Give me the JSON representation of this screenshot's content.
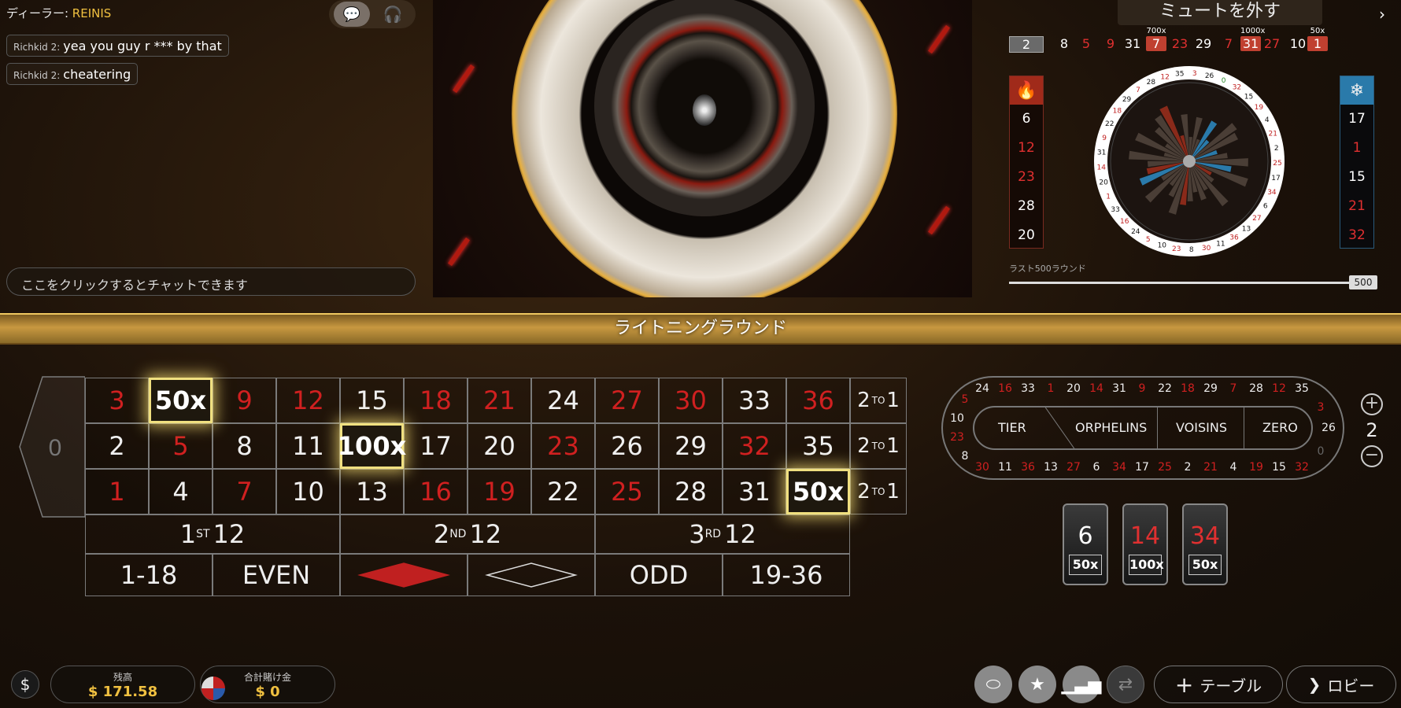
{
  "chat": {
    "dealer_label": "ディーラー:",
    "dealer_name": "REINIS",
    "messages": [
      {
        "user": "Richkid 2:",
        "text": "yea you guy r *** by that"
      },
      {
        "user": "Richkid 2:",
        "text": "cheatering"
      }
    ],
    "input_placeholder": "ここをクリックするとチャットできます"
  },
  "stats": {
    "mute_label": "ミュートを外す",
    "recent_results": [
      {
        "n": "2",
        "c": "w"
      },
      {
        "n": "8",
        "c": "w"
      },
      {
        "n": "5",
        "c": "r"
      },
      {
        "n": "9",
        "c": "r"
      },
      {
        "n": "31",
        "c": "w"
      },
      {
        "n": "7",
        "c": "r",
        "mult": "700x"
      },
      {
        "n": "23",
        "c": "r"
      },
      {
        "n": "29",
        "c": "w"
      },
      {
        "n": "7",
        "c": "r"
      },
      {
        "n": "31",
        "c": "w",
        "mult": "1000x"
      },
      {
        "n": "27",
        "c": "r"
      },
      {
        "n": "10",
        "c": "w"
      },
      {
        "n": "1",
        "c": "r",
        "mult": "50x"
      }
    ],
    "hot_numbers": [
      {
        "n": "6",
        "c": "w"
      },
      {
        "n": "12",
        "c": "r"
      },
      {
        "n": "23",
        "c": "r"
      },
      {
        "n": "28",
        "c": "w"
      },
      {
        "n": "20",
        "c": "w"
      }
    ],
    "cold_numbers": [
      {
        "n": "17",
        "c": "w"
      },
      {
        "n": "1",
        "c": "r"
      },
      {
        "n": "15",
        "c": "w"
      },
      {
        "n": "21",
        "c": "r"
      },
      {
        "n": "32",
        "c": "r"
      }
    ],
    "last_rounds_label": "ラスト500ラウンド",
    "slider_value": "500",
    "hot_icon": "flame-icon",
    "cold_icon": "snowflake-icon"
  },
  "banner": "ライトニングラウンド",
  "table": {
    "zero": "0",
    "rows": [
      [
        {
          "n": "3",
          "c": "r"
        },
        {
          "n": "50x",
          "c": "m"
        },
        {
          "n": "9",
          "c": "r"
        },
        {
          "n": "12",
          "c": "r"
        },
        {
          "n": "15",
          "c": "w"
        },
        {
          "n": "18",
          "c": "r"
        },
        {
          "n": "21",
          "c": "r"
        },
        {
          "n": "24",
          "c": "w"
        },
        {
          "n": "27",
          "c": "r"
        },
        {
          "n": "30",
          "c": "r"
        },
        {
          "n": "33",
          "c": "w"
        },
        {
          "n": "36",
          "c": "r"
        }
      ],
      [
        {
          "n": "2",
          "c": "w"
        },
        {
          "n": "5",
          "c": "r"
        },
        {
          "n": "8",
          "c": "w"
        },
        {
          "n": "11",
          "c": "w"
        },
        {
          "n": "100x",
          "c": "m"
        },
        {
          "n": "17",
          "c": "w"
        },
        {
          "n": "20",
          "c": "w"
        },
        {
          "n": "23",
          "c": "r"
        },
        {
          "n": "26",
          "c": "w"
        },
        {
          "n": "29",
          "c": "w"
        },
        {
          "n": "32",
          "c": "r"
        },
        {
          "n": "35",
          "c": "w"
        }
      ],
      [
        {
          "n": "1",
          "c": "r"
        },
        {
          "n": "4",
          "c": "w"
        },
        {
          "n": "7",
          "c": "r"
        },
        {
          "n": "10",
          "c": "w"
        },
        {
          "n": "13",
          "c": "w"
        },
        {
          "n": "16",
          "c": "r"
        },
        {
          "n": "19",
          "c": "r"
        },
        {
          "n": "22",
          "c": "w"
        },
        {
          "n": "25",
          "c": "r"
        },
        {
          "n": "28",
          "c": "w"
        },
        {
          "n": "31",
          "c": "w"
        },
        {
          "n": "50x",
          "c": "m"
        }
      ]
    ],
    "column_bet": {
      "a": "2",
      "sup": "TO",
      "b": "1"
    },
    "dozens": [
      {
        "a": "1",
        "sup": "ST",
        "b": "12"
      },
      {
        "a": "2",
        "sup": "ND",
        "b": "12"
      },
      {
        "a": "3",
        "sup": "RD",
        "b": "12"
      }
    ],
    "outside": [
      "1-18",
      "EVEN",
      "",
      "",
      "ODD",
      "19-36"
    ]
  },
  "racetrack": {
    "top": [
      {
        "n": "24",
        "c": "w"
      },
      {
        "n": "16",
        "c": "r"
      },
      {
        "n": "33",
        "c": "w"
      },
      {
        "n": "1",
        "c": "r"
      },
      {
        "n": "20",
        "c": "w"
      },
      {
        "n": "14",
        "c": "r"
      },
      {
        "n": "31",
        "c": "w"
      },
      {
        "n": "9",
        "c": "r"
      },
      {
        "n": "22",
        "c": "w"
      },
      {
        "n": "18",
        "c": "r"
      },
      {
        "n": "29",
        "c": "w"
      },
      {
        "n": "7",
        "c": "r"
      },
      {
        "n": "28",
        "c": "w"
      },
      {
        "n": "12",
        "c": "r"
      },
      {
        "n": "35",
        "c": "w"
      }
    ],
    "bottom": [
      {
        "n": "30",
        "c": "r"
      },
      {
        "n": "11",
        "c": "w"
      },
      {
        "n": "36",
        "c": "r"
      },
      {
        "n": "13",
        "c": "w"
      },
      {
        "n": "27",
        "c": "r"
      },
      {
        "n": "6",
        "c": "w"
      },
      {
        "n": "34",
        "c": "r"
      },
      {
        "n": "17",
        "c": "w"
      },
      {
        "n": "25",
        "c": "r"
      },
      {
        "n": "2",
        "c": "w"
      },
      {
        "n": "21",
        "c": "r"
      },
      {
        "n": "4",
        "c": "w"
      },
      {
        "n": "19",
        "c": "r"
      },
      {
        "n": "15",
        "c": "w"
      },
      {
        "n": "32",
        "c": "r"
      }
    ],
    "left": [
      {
        "n": "5",
        "c": "r"
      },
      {
        "n": "10",
        "c": "w"
      },
      {
        "n": "23",
        "c": "r"
      },
      {
        "n": "8",
        "c": "w"
      }
    ],
    "right": [
      {
        "n": "3",
        "c": "r"
      },
      {
        "n": "26",
        "c": "w"
      },
      {
        "n": "0",
        "c": "g"
      }
    ],
    "sections": [
      "TIER",
      "ORPHELINS",
      "VOISINS",
      "ZERO"
    ],
    "neighbors": "2"
  },
  "lightning": [
    {
      "n": "6",
      "c": "w",
      "m": "50x"
    },
    {
      "n": "14",
      "c": "r",
      "m": "100x"
    },
    {
      "n": "34",
      "c": "r",
      "m": "50x"
    }
  ],
  "footer": {
    "balance_label": "残高",
    "balance": "$ 171.58",
    "total_bet_label": "合計賭け金",
    "total_bet": "$ 0",
    "table_button": "テーブル",
    "lobby_button": "ロビー"
  },
  "colors": {
    "red": "#d02020",
    "gold": "#f0c040"
  }
}
